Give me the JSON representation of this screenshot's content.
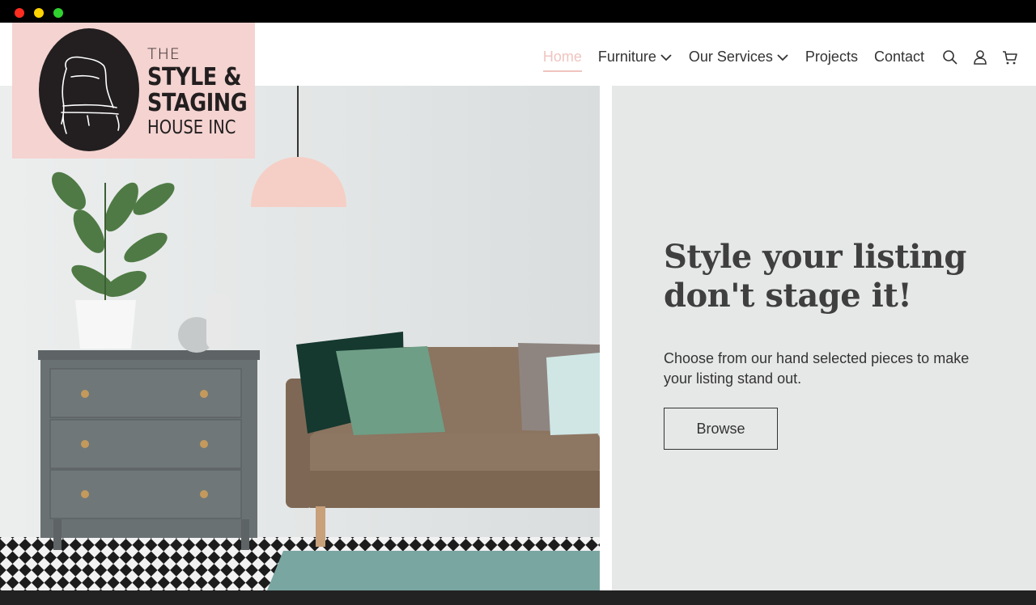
{
  "logo": {
    "line1": "THE",
    "line2": "STYLE &",
    "line3": "STAGING",
    "line4": "HOUSE INC"
  },
  "nav": {
    "items": [
      {
        "label": "Home",
        "active": true
      },
      {
        "label": "Furniture",
        "dropdown": true
      },
      {
        "label": "Our Services",
        "dropdown": true
      },
      {
        "label": "Projects"
      },
      {
        "label": "Contact"
      }
    ],
    "icons": [
      "search-icon",
      "account-icon",
      "cart-icon"
    ]
  },
  "hero": {
    "headline": "Style your listing don't stage it!",
    "subtext": "Choose from our hand selected pieces to make your listing stand out.",
    "button_label": "Browse"
  },
  "colors": {
    "brand_pink": "#f4d3d0",
    "active_nav": "#f0c4c0",
    "panel_bg": "#e6e8e7",
    "text_dark": "#333333"
  }
}
